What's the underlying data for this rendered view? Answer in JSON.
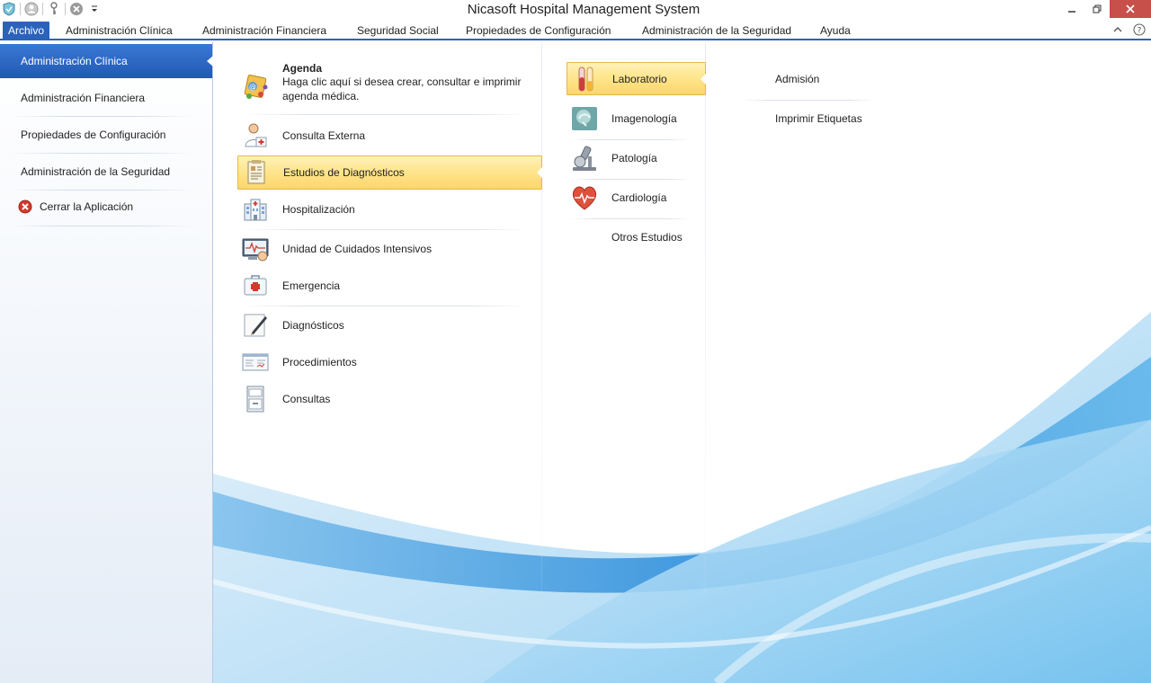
{
  "window": {
    "title": "Nicasoft Hospital Management System"
  },
  "menubar": {
    "items": [
      "Archivo",
      "Administración Clínica",
      "Administración Financiera",
      "Seguridad Social",
      "Propiedades de Configuración",
      "Administración de la Seguridad",
      "Ayuda"
    ]
  },
  "sidebar": {
    "items": [
      "Administración Clínica",
      "Administración Financiera",
      "Propiedades de Configuración",
      "Administración de la Seguridad"
    ],
    "exit_label": "Cerrar la Aplicación"
  },
  "column1": {
    "agenda_title": "Agenda",
    "agenda_desc": "Haga clic aquí si desea crear, consultar e imprimir agenda médica.",
    "items": [
      "Consulta Externa",
      "Estudios de Diagnósticos",
      "Hospitalización",
      "Unidad de Cuidados Intensivos",
      "Emergencia",
      "Diagnósticos",
      "Procedimientos",
      "Consultas"
    ]
  },
  "column2": {
    "items": [
      "Laboratorio",
      "Imagenología",
      "Patología",
      "Cardiología",
      "Otros Estudios"
    ]
  },
  "column3": {
    "items": [
      "Admisión",
      "Imprimir Etiquetas"
    ]
  },
  "colors": {
    "accent": "#2b63ba",
    "selection": "#fee48a",
    "close": "#c7504a"
  }
}
